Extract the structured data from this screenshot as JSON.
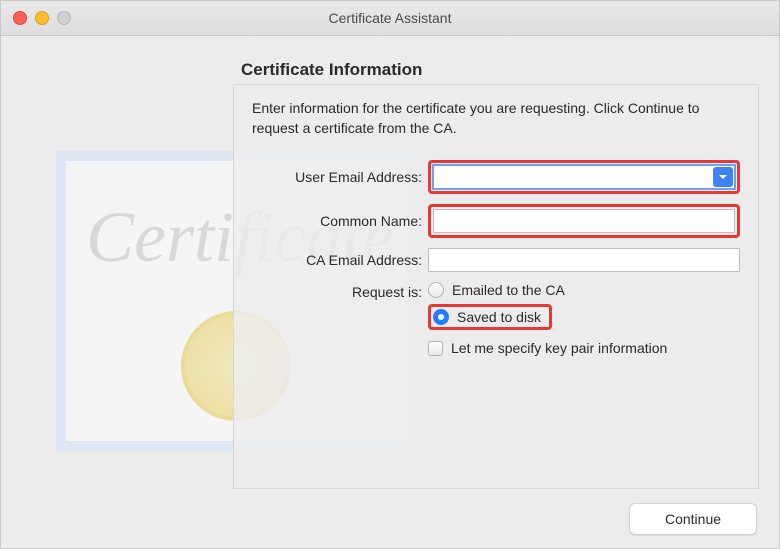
{
  "window": {
    "title": "Certificate Assistant"
  },
  "page": {
    "heading": "Certificate Information",
    "instructions": "Enter information for the certificate you are requesting. Click Continue to request a certificate from the CA."
  },
  "form": {
    "user_email_label": "User Email Address:",
    "user_email_value": "",
    "common_name_label": "Common Name:",
    "common_name_value": "",
    "ca_email_label": "CA Email Address:",
    "ca_email_value": "",
    "request_is_label": "Request is:",
    "radio_emailed": "Emailed to the CA",
    "radio_saved": "Saved to disk",
    "radio_selected": "saved",
    "checkbox_label": "Let me specify key pair information"
  },
  "footer": {
    "continue_label": "Continue"
  },
  "graphic": {
    "script_text": "Certificate"
  }
}
